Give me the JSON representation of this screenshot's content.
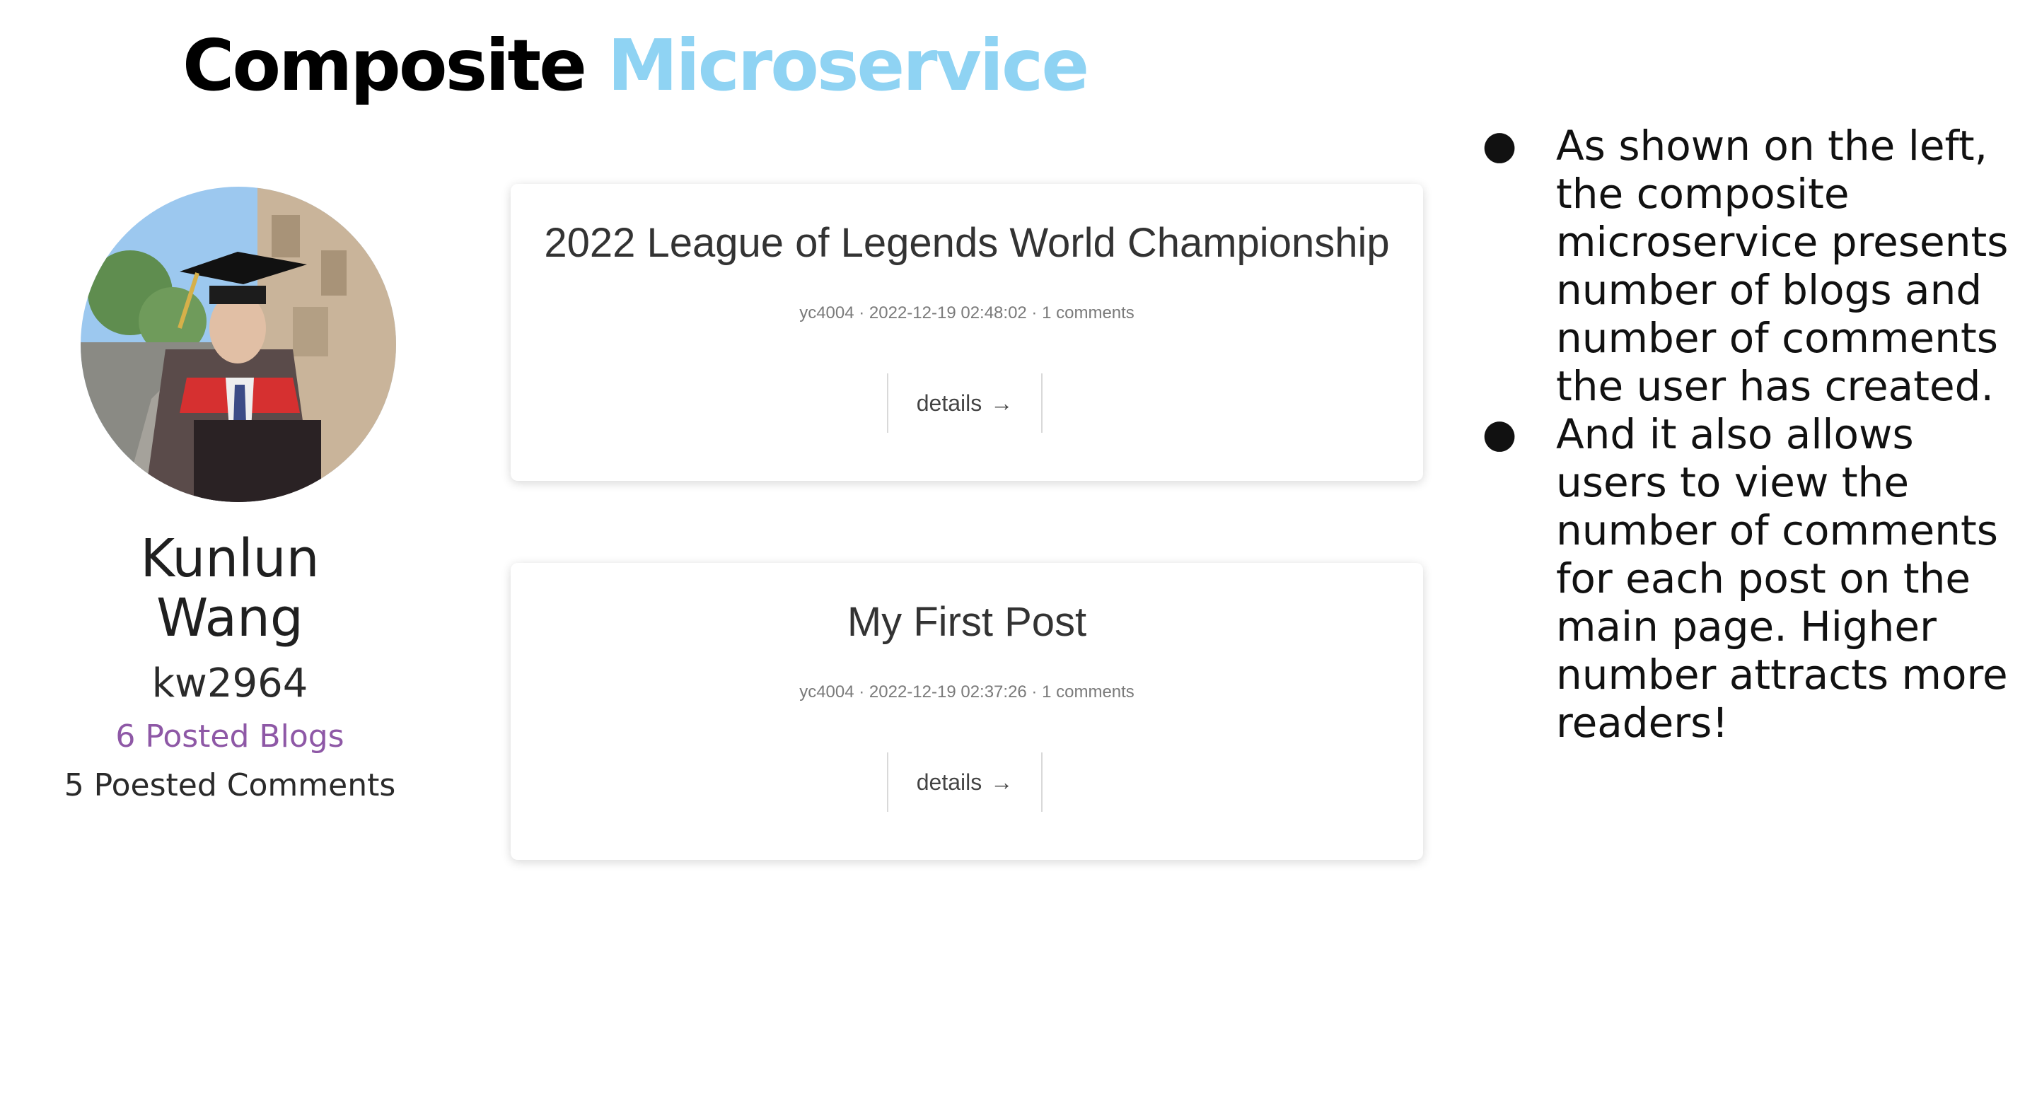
{
  "slide": {
    "title_main": "Composite",
    "title_accent": "Microservice"
  },
  "profile": {
    "name": "Kunlun Wang",
    "username": "kw2964",
    "blogs": "6 Posted Blogs",
    "comments": "5 Poested Comments"
  },
  "posts": [
    {
      "title": "2022 League of Legends World Championship",
      "meta": "yc4004 · 2022-12-19 02:48:02 · 1 comments",
      "details_label": "details",
      "details_arrow": "→"
    },
    {
      "title": "My First Post",
      "meta": "yc4004 · 2022-12-19 02:37:26 · 1 comments",
      "details_label": "details",
      "details_arrow": "→"
    }
  ],
  "notes": {
    "bullet_glyph": "●",
    "items": [
      "As shown on the left, the composite microservice presents number of blogs and number of comments the user has created.",
      "And it also allows users to view the number of comments for each post on the main page. Higher number attracts more readers!"
    ]
  },
  "colors": {
    "accent": "#8fd3f3",
    "blogs_link": "#8e58a6"
  }
}
